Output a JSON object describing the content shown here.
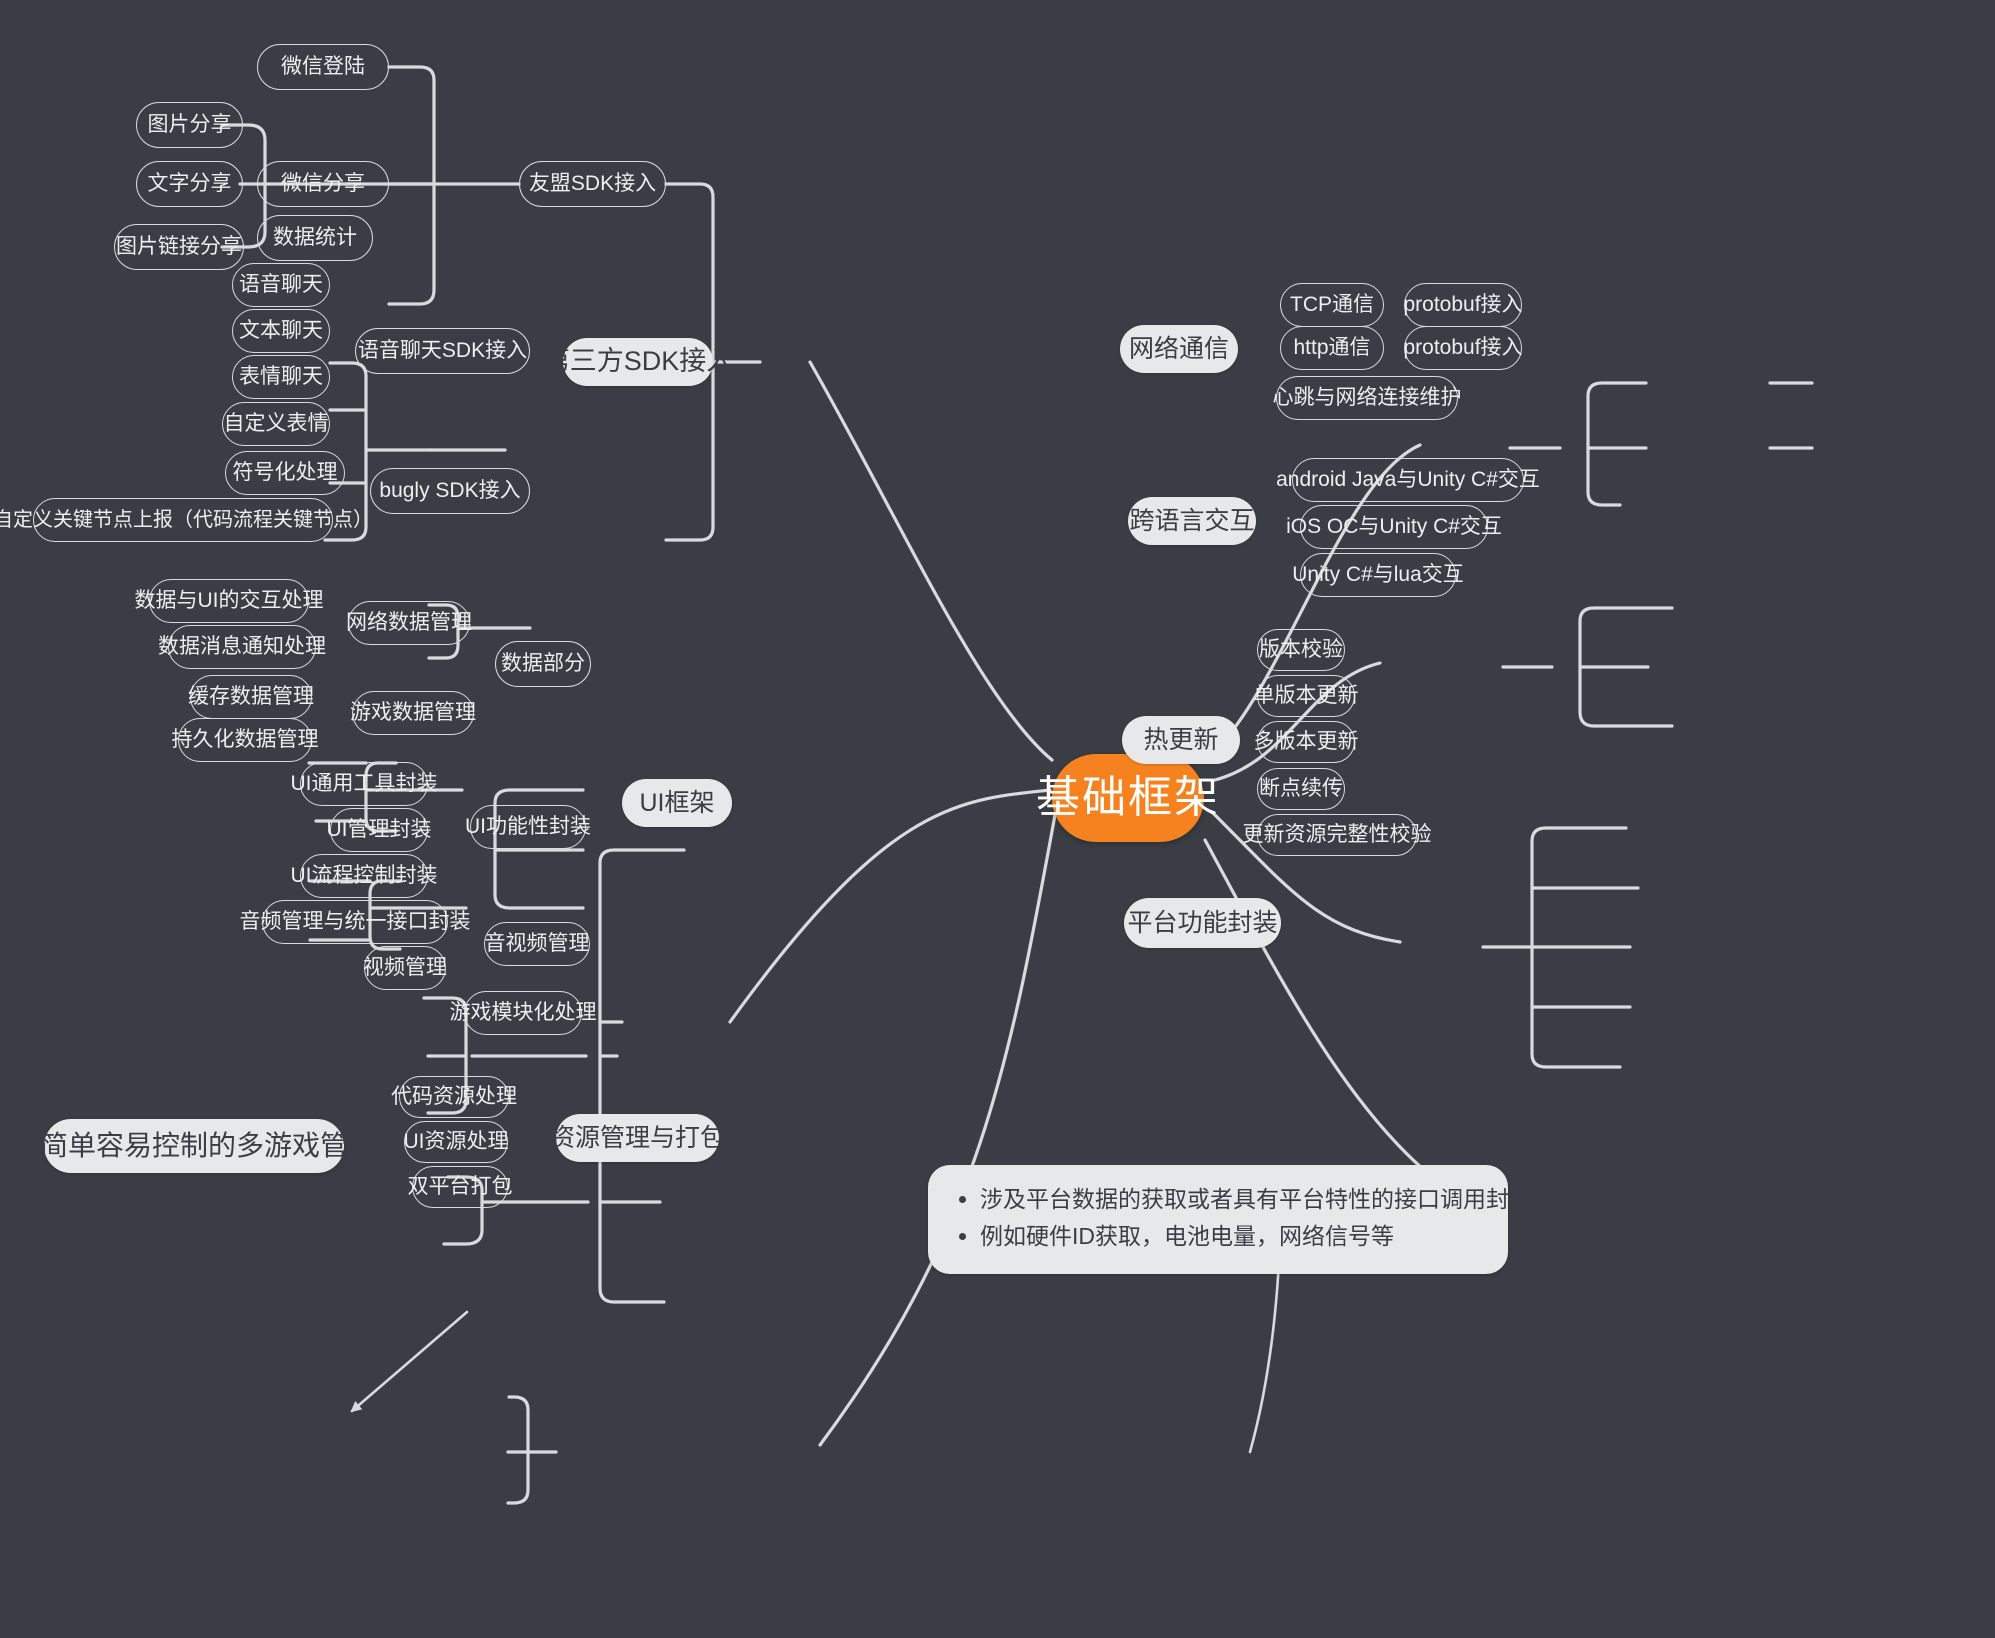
{
  "theme": {
    "canvas_bg": "#3a3e44",
    "root_color": "#f5821f",
    "branch_bg": "#e7e8ea",
    "branch_text": "#3a3e44",
    "leaf_text": "#eceef0",
    "line_color": "#d8dadd"
  },
  "root": {
    "label": "基础框架"
  },
  "branches": {
    "sdk": {
      "label": "第三方SDK接入",
      "children": {
        "umeng": {
          "label": "友盟SDK接入",
          "children": [
            {
              "label": "微信登陆"
            },
            {
              "label": "微信分享",
              "children": [
                {
                  "label": "图片分享"
                },
                {
                  "label": "文字分享"
                },
                {
                  "label": "图片链接分享"
                }
              ]
            },
            {
              "label": "数据统计"
            }
          ]
        },
        "voice": {
          "label": "语音聊天SDK接入",
          "children": [
            {
              "label": "语音聊天"
            },
            {
              "label": "文本聊天"
            },
            {
              "label": "表情聊天"
            },
            {
              "label": "自定义表情"
            }
          ]
        },
        "bugly": {
          "label": "bugly SDK接入",
          "children": [
            {
              "label": "符号化处理"
            },
            {
              "label": "自定义关键节点上报（代码流程关键节点）"
            }
          ]
        }
      }
    },
    "network": {
      "label": "网络通信",
      "children": [
        {
          "label": "TCP通信",
          "children": [
            {
              "label": "protobuf接入"
            }
          ]
        },
        {
          "label": "http通信",
          "children": [
            {
              "label": "protobuf接入"
            }
          ]
        },
        {
          "label": "心跳与网络连接维护"
        }
      ]
    },
    "crosslang": {
      "label": "跨语言交互",
      "children": [
        {
          "label": "android Java与Unity C#交互"
        },
        {
          "label": "iOS OC与Unity C#交互"
        },
        {
          "label": "Unity C#与lua交互"
        }
      ]
    },
    "hotupdate": {
      "label": "热更新",
      "children": [
        {
          "label": "版本校验"
        },
        {
          "label": "单版本更新"
        },
        {
          "label": "多版本更新"
        },
        {
          "label": "断点续传"
        },
        {
          "label": "更新资源完整性校验"
        }
      ]
    },
    "platform": {
      "label": "平台功能封装",
      "note": [
        "涉及平台数据的获取或者具有平台特性的接口调用封装平台",
        "例如硬件ID获取，电池电量，网络信号等"
      ]
    },
    "uiframework": {
      "label": "UI框架",
      "children": {
        "data": {
          "label": "数据部分",
          "children": [
            {
              "label": "网络数据管理",
              "children": [
                {
                  "label": "数据与UI的交互处理"
                },
                {
                  "label": "数据消息通知处理"
                }
              ]
            },
            {
              "label": "游戏数据管理",
              "children": [
                {
                  "label": "缓存数据管理"
                },
                {
                  "label": "持久化数据管理"
                }
              ]
            }
          ]
        },
        "uifunc": {
          "label": "UI功能性封装",
          "children": [
            {
              "label": "UI通用工具封装"
            },
            {
              "label": "UI管理封装"
            },
            {
              "label": "UI流程控制封装"
            }
          ]
        },
        "av": {
          "label": "音视频管理",
          "children": [
            {
              "label": "音频管理与统一接口封装"
            },
            {
              "label": "视频管理"
            }
          ]
        },
        "modular": {
          "label": "游戏模块化处理",
          "goal": {
            "label": "更简单容易控制的多游戏管理"
          }
        }
      }
    },
    "resource": {
      "label": "资源管理与打包",
      "children": [
        {
          "label": "代码资源处理"
        },
        {
          "label": "UI资源处理"
        },
        {
          "label": "双平台打包"
        }
      ]
    }
  }
}
